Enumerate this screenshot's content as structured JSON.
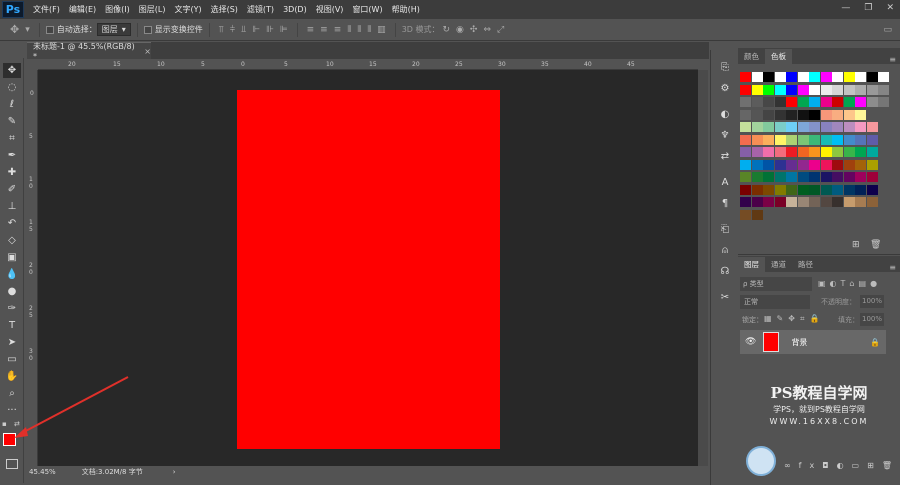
{
  "app": {
    "logo": "Ps"
  },
  "menubar": {
    "items": [
      "文件(F)",
      "编辑(E)",
      "图像(I)",
      "图层(L)",
      "文字(Y)",
      "选择(S)",
      "滤镜(T)",
      "3D(D)",
      "视图(V)",
      "窗口(W)",
      "帮助(H)"
    ]
  },
  "options": {
    "auto_select_label": "自动选择：",
    "auto_select_value": "图层",
    "show_transform_label": "显示变换控件",
    "mode_3d_label": "3D 模式："
  },
  "document": {
    "tab_title": "未标题-1 @ 45.5%(RGB/8) *",
    "tab_close": "×"
  },
  "status": {
    "zoom": "45.45%",
    "doc_info": "文档:3.02M/8 字节"
  },
  "ruler": {
    "top": [
      "20",
      "15",
      "10",
      "5",
      "0",
      "5",
      "10",
      "15",
      "20",
      "25",
      "30",
      "35",
      "40",
      "45"
    ],
    "left": [
      "0",
      "5",
      "1 0",
      "1 5",
      "2 0",
      "2 5",
      "3 0"
    ]
  },
  "panels": {
    "color_tab": "颜色",
    "swatches_tab": "色板",
    "layers_tab": "图层",
    "channels_tab": "通道",
    "paths_tab": "路径",
    "kind_filter": "ρ 类型",
    "blend_mode": "正常",
    "opacity_label": "不透明度：",
    "opacity_value": "100%",
    "lock_label": "锁定：",
    "fill_label": "填充：",
    "fill_value": "100%",
    "layer_name": "背景"
  },
  "watermark": {
    "line1": "PS教程自学网",
    "line2": "学PS，就到PS教程自学网",
    "line3": "WWW.16XX8.COM"
  },
  "colors": {
    "canvas": "#ff0000",
    "foreground": "#ff0000",
    "background": "#ffffff",
    "workspace": "#282828",
    "arrow": "#e0302a"
  },
  "swatch_rows": [
    [
      "#ff0000",
      "#ffffff",
      "#000000",
      "#ffffff",
      "#0000ff",
      "#ffffff",
      "#00ffff",
      "#ff00ff",
      "#ffffff",
      "#ffff00",
      "#ffffff",
      "#000000",
      "#ffffff"
    ],
    [
      "#ff0000",
      "#ffff00",
      "#00ff00",
      "#00ffff",
      "#0000ff",
      "#ff00ff",
      "#ffffff",
      "#ebebeb",
      "#d6d6d6",
      "#c2c2c2",
      "#adadad",
      "#999999",
      "#858585"
    ],
    [
      "#707070",
      "#5c5c5c",
      "#474747",
      "#333333",
      "#ff0000",
      "#00a651",
      "#00aeef",
      "#ec008c",
      "#cc0000",
      "#00a651",
      "#ff00ff",
      "#8c8c8c",
      "#767676"
    ],
    [
      "#666666",
      "#555555",
      "#444444",
      "#333333",
      "#222222",
      "#111111",
      "#000000",
      "#f7977a",
      "#f9ad81",
      "#fdc68a",
      "#fff79a"
    ],
    [
      "#c4df9b",
      "#a2d39c",
      "#82ca9d",
      "#7bcdc8",
      "#6ecff6",
      "#7ea7d8",
      "#8493ca",
      "#8882be",
      "#a187be",
      "#bc8dbf",
      "#f49ac2",
      "#f6989d"
    ],
    [
      "#f26c4f",
      "#f68e55",
      "#fbaf5c",
      "#fff467",
      "#acd372",
      "#7cc576",
      "#3bb878",
      "#1abbb4",
      "#00bff3",
      "#438ccb",
      "#5574b9",
      "#605ca8"
    ],
    [
      "#855fa8",
      "#a763a8",
      "#f06eaa",
      "#f26d7d",
      "#ed1c24",
      "#f26522",
      "#f7941d",
      "#fff200",
      "#8dc73f",
      "#39b54a",
      "#00a651",
      "#00a99d"
    ],
    [
      "#00aeef",
      "#0072bc",
      "#0054a6",
      "#2e3192",
      "#662d91",
      "#92278f",
      "#ec008c",
      "#ed145b",
      "#9e0b0f",
      "#a0410d",
      "#a36209",
      "#aba000"
    ],
    [
      "#598527",
      "#1a7b30",
      "#007236",
      "#00746b",
      "#0076a3",
      "#004b80",
      "#003471",
      "#1b1464",
      "#440e62",
      "#630460",
      "#9e005d",
      "#9e0039"
    ],
    [
      "#790000",
      "#7b2e00",
      "#7d4900",
      "#827b00",
      "#406618",
      "#005e20",
      "#005826",
      "#005952",
      "#005b7f",
      "#003663",
      "#002157",
      "#0d004c"
    ],
    [
      "#32004b",
      "#4b0049",
      "#7b0046",
      "#7a0026",
      "#c7b299",
      "#998675",
      "#736357",
      "#534741",
      "#37302d",
      "#c69c6d",
      "#a67c52",
      "#8c6239"
    ],
    [
      "#754c24",
      "#603913"
    ]
  ]
}
